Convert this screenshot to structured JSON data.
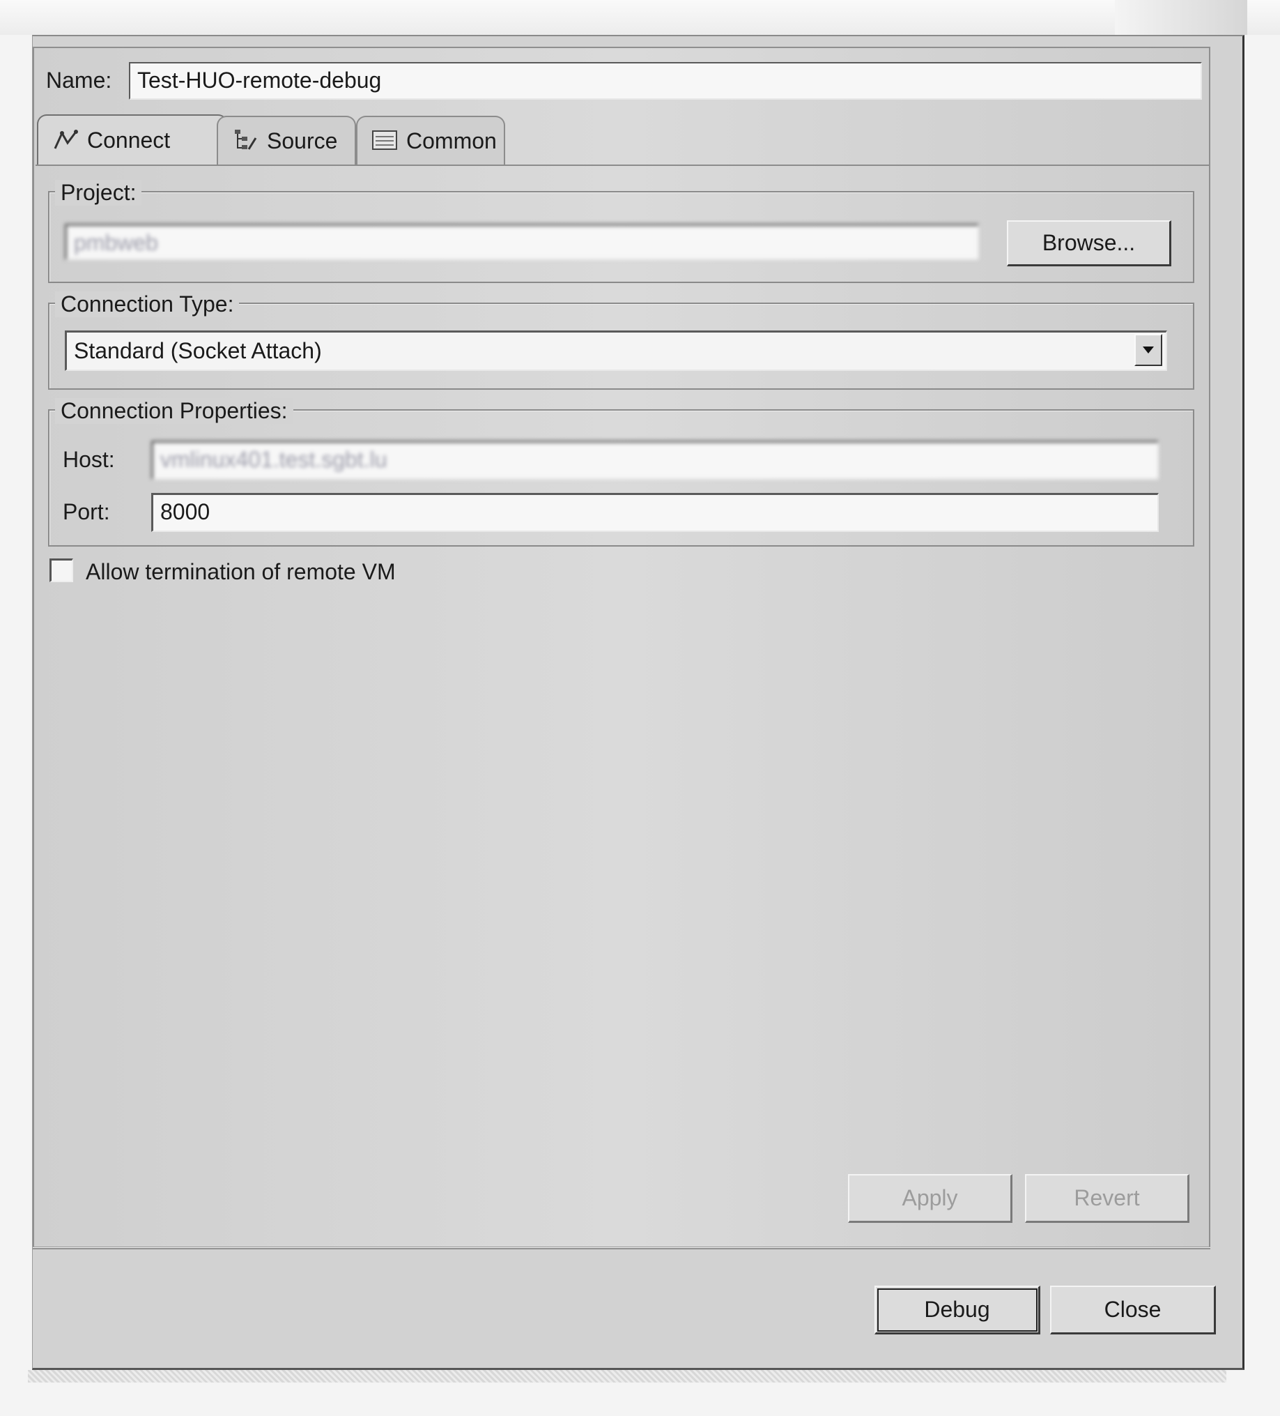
{
  "name": {
    "label": "Name:",
    "value": "Test-HUO-remote-debug"
  },
  "tabs": [
    {
      "label": "Connect",
      "icon": "connect-icon",
      "active": true
    },
    {
      "label": "Source",
      "icon": "source-icon",
      "active": false
    },
    {
      "label": "Common",
      "icon": "common-icon",
      "active": false
    }
  ],
  "project": {
    "group_label": "Project:",
    "value": "pmbweb",
    "browse_label": "Browse..."
  },
  "connection_type": {
    "group_label": "Connection Type:",
    "selected": "Standard (Socket Attach)"
  },
  "connection_properties": {
    "group_label": "Connection Properties:",
    "host_label": "Host:",
    "host_value": "vmlinux401.test.sgbt.lu",
    "port_label": "Port:",
    "port_value": "8000"
  },
  "allow_termination": {
    "label": "Allow termination of remote VM",
    "checked": false
  },
  "panel_buttons": {
    "apply": "Apply",
    "revert": "Revert"
  },
  "dialog_buttons": {
    "debug": "Debug",
    "close": "Close"
  },
  "colors": {
    "dialog_bg": "#d2d2d2",
    "field_bg": "#f7f7f7",
    "disabled_text": "#9c9c9c"
  }
}
